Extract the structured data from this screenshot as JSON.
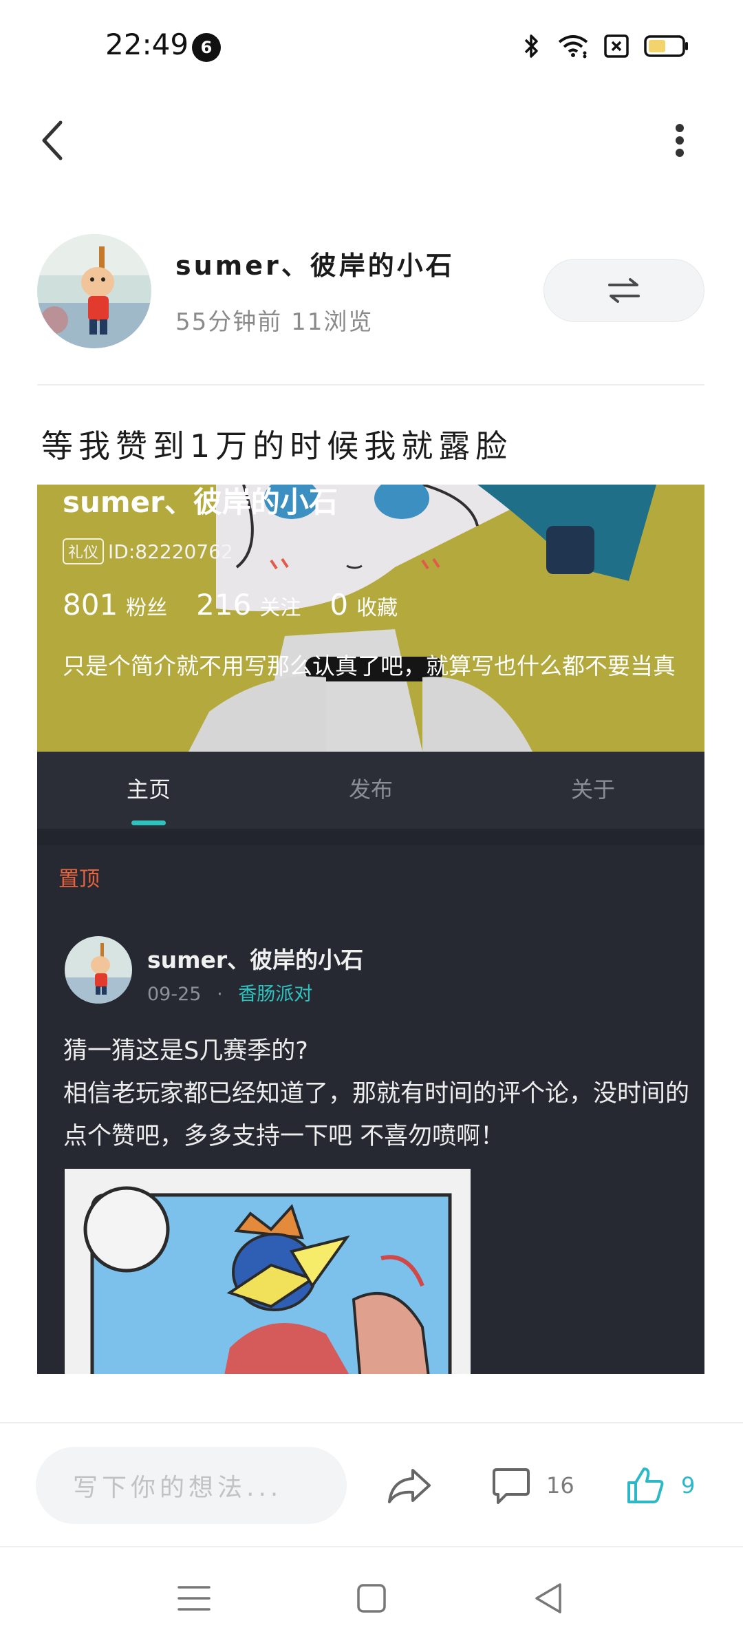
{
  "status_bar": {
    "time": "22:49",
    "notification_count": "6",
    "icons": [
      "bluetooth-icon",
      "wifi-icon",
      "sim-off-icon",
      "battery-icon"
    ]
  },
  "top_bar": {
    "back_icon": "chevron-left-icon",
    "more_icon": "more-vertical-icon"
  },
  "post": {
    "author": "sumer、彼岸的小石",
    "meta": "55分钟前 11浏览",
    "share_icon": "swap-arrows-icon",
    "title": "等我赞到1万的时候我就露脸"
  },
  "screenshot": {
    "profile": {
      "name": "sumer、彼岸的小石",
      "tag": "礼仪",
      "id": "ID:82220762",
      "stats": [
        {
          "value": "801",
          "label": "粉丝"
        },
        {
          "value": "216",
          "label": "关注"
        },
        {
          "value": "0",
          "label": "收藏"
        }
      ],
      "bio": "只是个简介就不用写那么认真了吧，就算写也什么都不要当真"
    },
    "tabs": [
      {
        "label": "主页",
        "active": true
      },
      {
        "label": "发布",
        "active": false
      },
      {
        "label": "关于",
        "active": false
      }
    ],
    "pinned_label": "置顶",
    "pinned_post": {
      "author": "sumer、彼岸的小石",
      "date": "09-25",
      "separator": "·",
      "topic": "香肠派对",
      "line1": "猜一猜这是S几赛季的?",
      "line2": "相信老玩家都已经知道了，那就有时间的评个论，没时间的点个赞吧，多多支持一下吧 不喜勿喷啊！"
    }
  },
  "bottom_bar": {
    "comment_placeholder": "写下你的想法...",
    "share_icon": "share-forward-icon",
    "comment_icon": "comment-bubble-icon",
    "comment_count": "16",
    "like_icon": "thumbs-up-icon",
    "like_count": "9",
    "colors": {
      "accent": "#2cb8c7",
      "pinned": "#e7643e",
      "topic": "#2fc3bf"
    }
  },
  "nav_bar": [
    "menu-icon",
    "home-square-icon",
    "back-triangle-icon"
  ]
}
